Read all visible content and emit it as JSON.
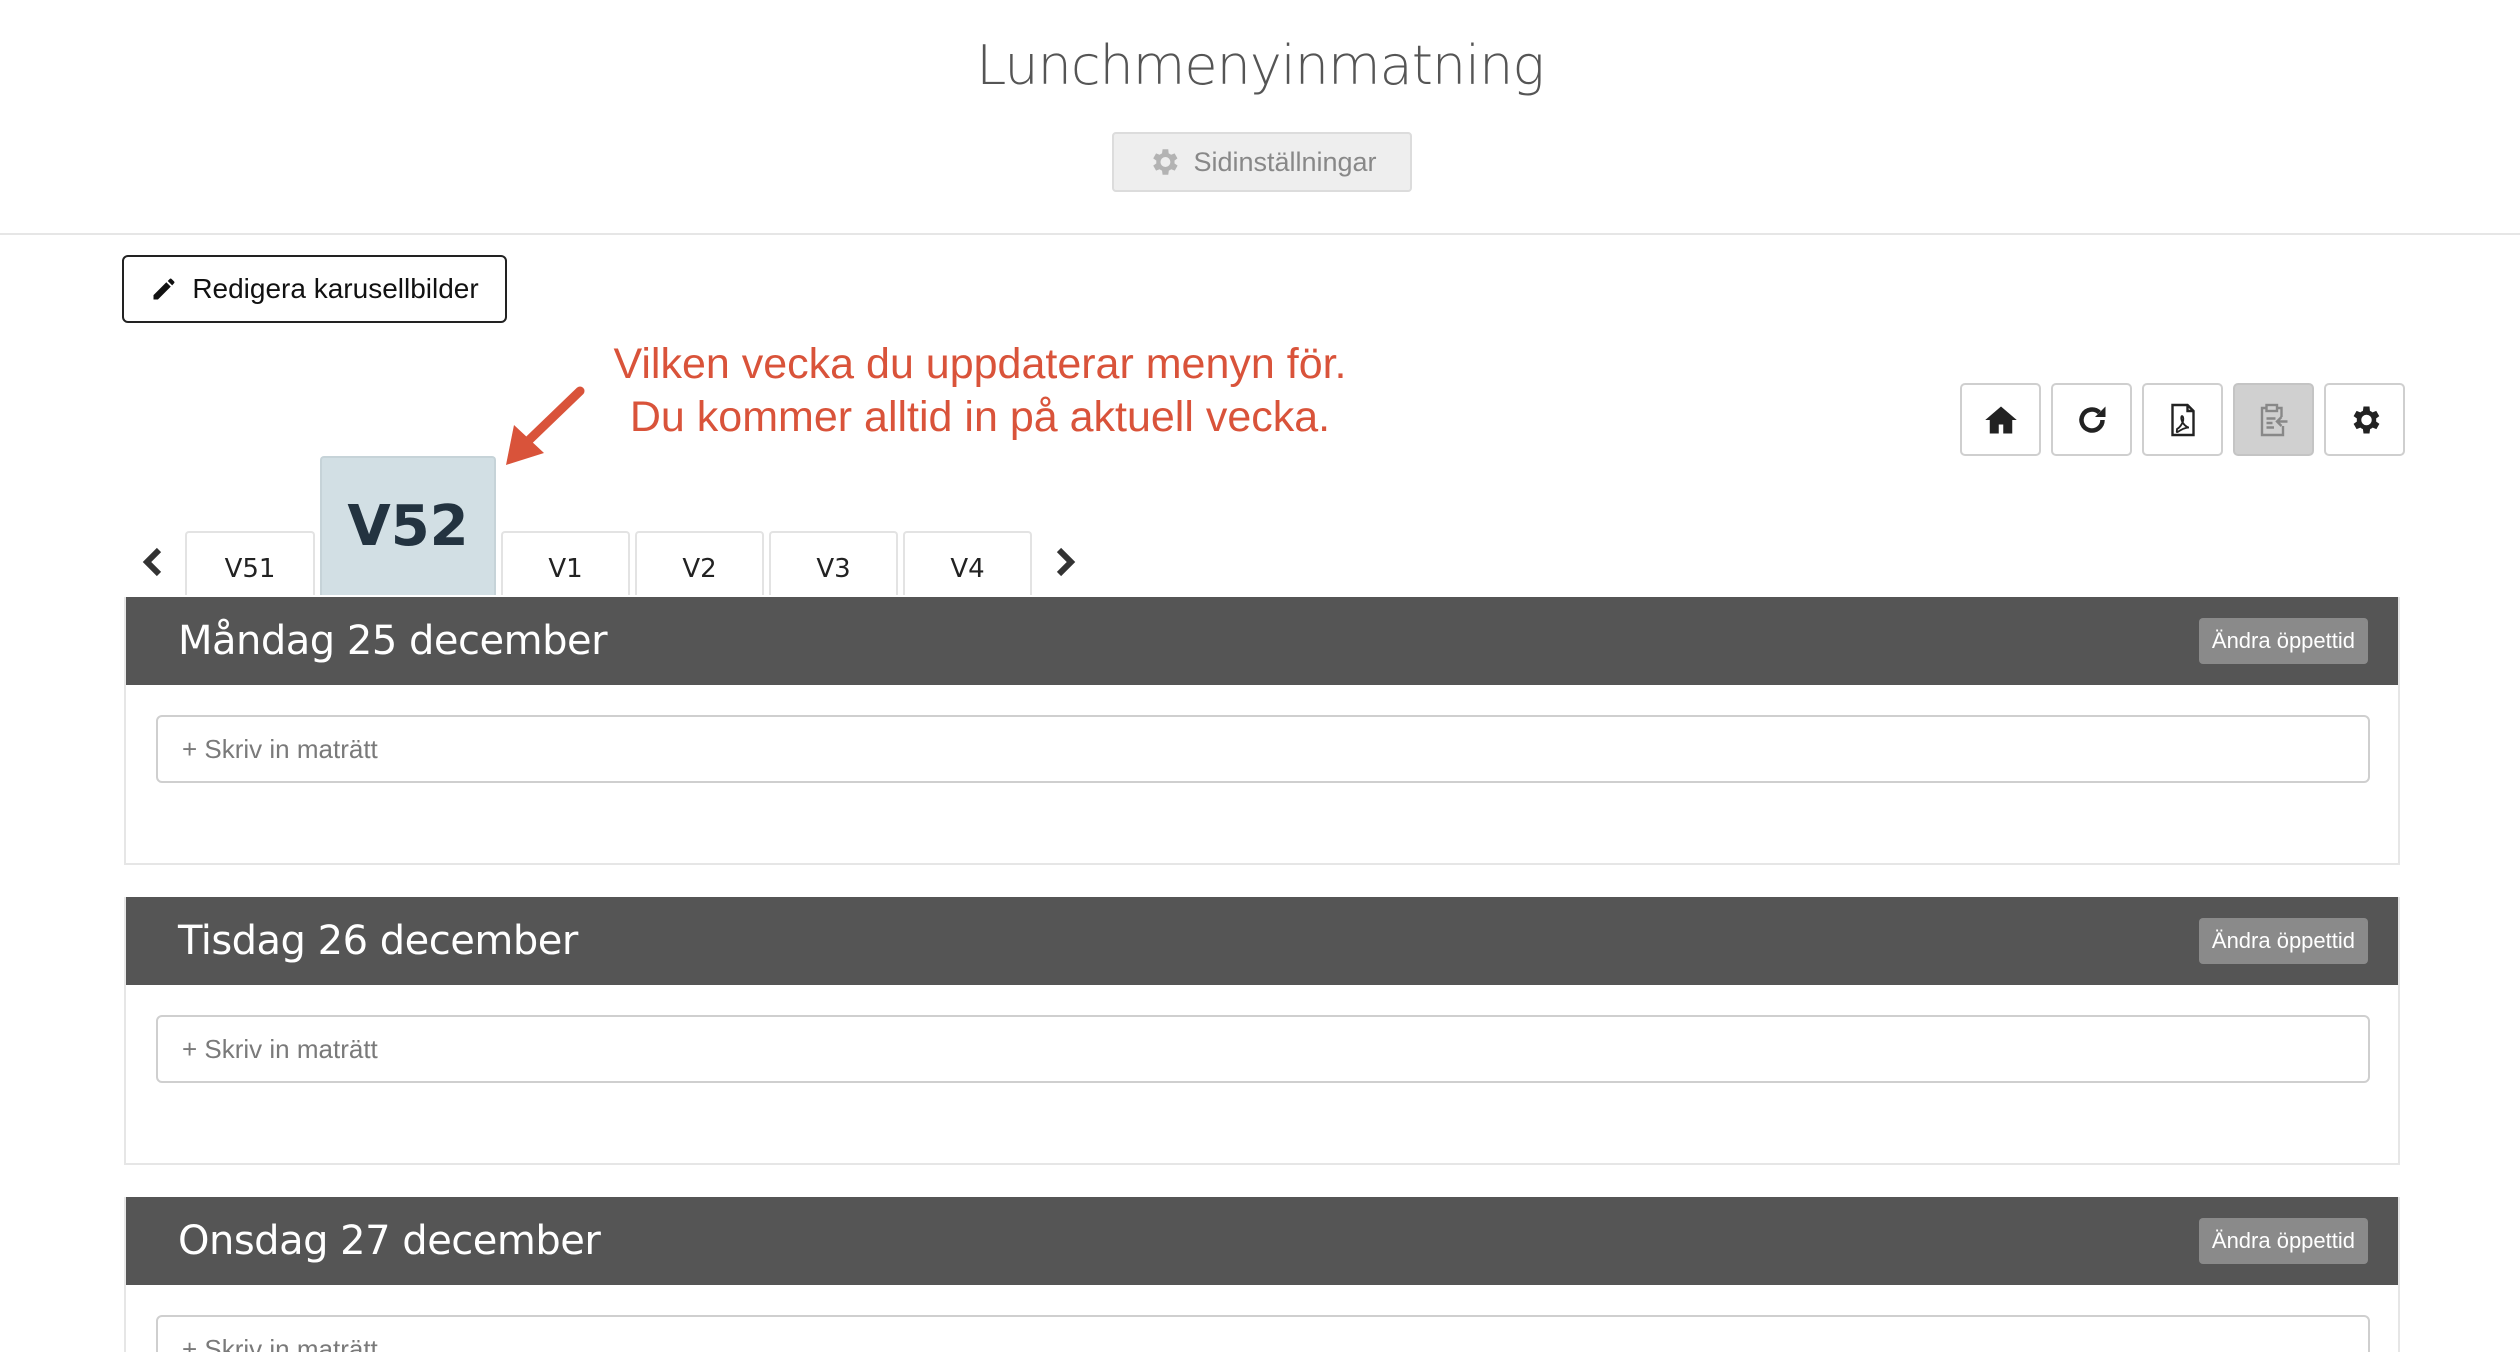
{
  "header": {
    "title": "Lunchmenyinmatning",
    "settings_label": "Sidinställningar"
  },
  "edit_carousel_label": "Redigera karusellbilder",
  "annotation": {
    "line1": "Vilken vecka du uppdaterar menyn för.",
    "line2": "Du kommer alltid in på aktuell vecka.",
    "color": "#d9533a"
  },
  "toolbar": {
    "buttons": [
      {
        "icon": "home-icon"
      },
      {
        "icon": "refresh-icon"
      },
      {
        "icon": "pdf-icon"
      },
      {
        "icon": "paste-icon",
        "active": true
      },
      {
        "icon": "gear-icon"
      }
    ]
  },
  "weeks": {
    "tabs": [
      "V51",
      "V52",
      "V1",
      "V2",
      "V3",
      "V4"
    ],
    "current": "V52"
  },
  "days": [
    {
      "title": "Måndag 25 december",
      "open_label": "Ändra öppettid",
      "placeholder": "+ Skriv in maträtt"
    },
    {
      "title": "Tisdag 26 december",
      "open_label": "Ändra öppettid",
      "placeholder": "+ Skriv in maträtt"
    },
    {
      "title": "Onsdag 27 december",
      "open_label": "Ändra öppettid",
      "placeholder": "+ Skriv in maträtt"
    }
  ],
  "colors": {
    "day_header": "#555555",
    "current_week_tab": "#d2dfe4"
  }
}
